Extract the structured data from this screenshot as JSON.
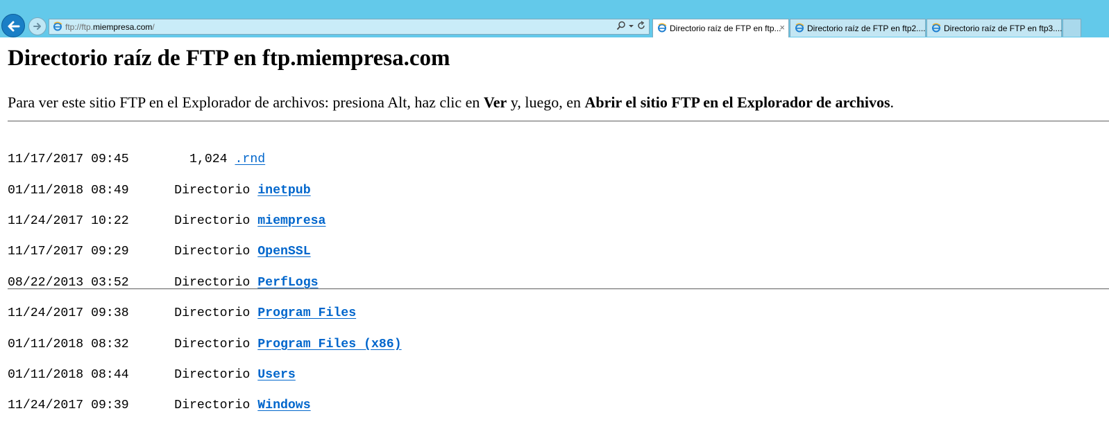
{
  "browser": {
    "url_prefix": "ftp://ftp.",
    "url_host": "miempresa.com",
    "url_suffix": "/",
    "tabs": [
      {
        "label": "Directorio raíz de FTP en ftp...",
        "active": true,
        "close": "×"
      },
      {
        "label": "Directorio raíz de FTP en ftp2....",
        "active": false
      },
      {
        "label": "Directorio raíz de FTP en ftp3....",
        "active": false
      }
    ],
    "icons": [
      "back-arrow-icon",
      "forward-arrow-icon",
      "ie-page-icon",
      "search-icon",
      "dropdown-icon",
      "refresh-icon"
    ],
    "colors": {
      "chrome_bg": "#63c9ea",
      "back_button": "#1a7fc6",
      "link": "#0066cc"
    }
  },
  "page": {
    "title": "Directorio raíz de FTP en ftp.miempresa.com",
    "instructions": {
      "part1": "Para ver este sitio FTP en el Explorador de archivos: presiona Alt, haz clic en ",
      "bold1": "Ver",
      "part2": " y, luego, en ",
      "bold2": "Abrir el sitio FTP en el Explorador de archivos",
      "part3": "."
    },
    "entries": [
      {
        "date": "11/17/2017",
        "time": "09:45",
        "size": "1,024",
        "name": ".rnd",
        "is_dir": false
      },
      {
        "date": "01/11/2018",
        "time": "08:49",
        "size": "Directorio",
        "name": "inetpub",
        "is_dir": true
      },
      {
        "date": "11/24/2017",
        "time": "10:22",
        "size": "Directorio",
        "name": "miempresa",
        "is_dir": true
      },
      {
        "date": "11/17/2017",
        "time": "09:29",
        "size": "Directorio",
        "name": "OpenSSL",
        "is_dir": true
      },
      {
        "date": "08/22/2013",
        "time": "03:52",
        "size": "Directorio",
        "name": "PerfLogs",
        "is_dir": true
      },
      {
        "date": "11/24/2017",
        "time": "09:38",
        "size": "Directorio",
        "name": "Program Files",
        "is_dir": true
      },
      {
        "date": "01/11/2018",
        "time": "08:32",
        "size": "Directorio",
        "name": "Program Files (x86)",
        "is_dir": true
      },
      {
        "date": "01/11/2018",
        "time": "08:44",
        "size": "Directorio",
        "name": "Users",
        "is_dir": true
      },
      {
        "date": "11/24/2017",
        "time": "09:39",
        "size": "Directorio",
        "name": "Windows",
        "is_dir": true
      }
    ]
  }
}
